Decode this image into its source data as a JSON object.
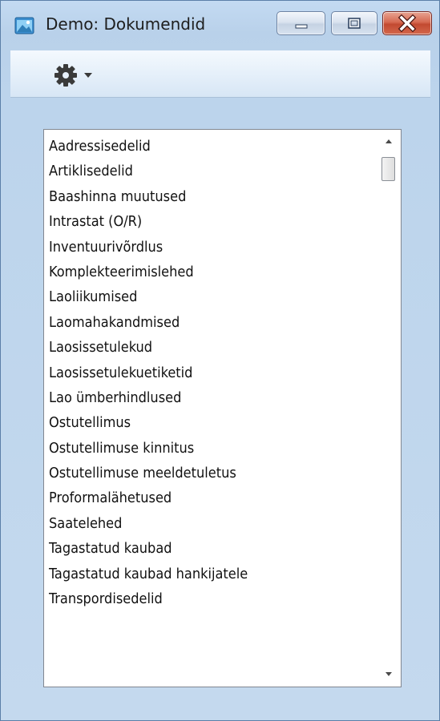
{
  "window": {
    "title": "Demo: Dokumendid",
    "app_icon": "app-window-icon",
    "controls": {
      "minimize_icon": "minimize-icon",
      "maximize_icon": "maximize-icon",
      "close_icon": "close-icon"
    }
  },
  "toolbar": {
    "menu_icon": "gear-icon",
    "menu_arrow": "chevron-down-icon"
  },
  "documents": {
    "items": [
      "Aadressisedelid",
      "Artiklisedelid",
      "Baashinna muutused",
      "Intrastat (O/R)",
      "Inventuurivõrdlus",
      "Komplekteerimislehed",
      "Laoliikumised",
      "Laomahakandmised",
      "Laosissetulekud",
      "Laosissetulekuetiketid",
      "Lao ümberhindlused",
      "Ostutellimus",
      "Ostutellimuse kinnitus",
      "Ostutellimuse meeldetuletus",
      "Proformalähetused",
      "Saatelehed",
      "Tagastatud kaubad",
      "Tagastatud kaubad hankijatele",
      "Transpordisedelid"
    ]
  },
  "colors": {
    "window_frame": "#bcd4ec",
    "close_button": "#c24a31",
    "list_background": "#ffffff"
  }
}
